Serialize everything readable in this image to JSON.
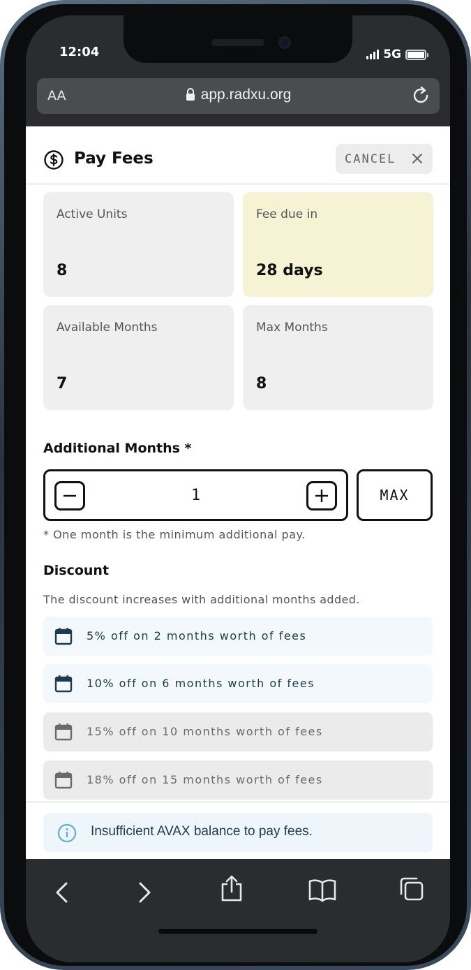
{
  "status_bar": {
    "time": "12:04",
    "network": "5G"
  },
  "browser": {
    "text_size_label": "AA",
    "url": "app.radxu.org"
  },
  "header": {
    "title": "Pay Fees",
    "cancel_label": "CANCEL"
  },
  "stats": [
    {
      "label": "Active Units",
      "value": "8",
      "highlight": false
    },
    {
      "label": "Fee due in",
      "value": "28 days",
      "highlight": true
    },
    {
      "label": "Available Months",
      "value": "7",
      "highlight": false
    },
    {
      "label": "Max Months",
      "value": "8",
      "highlight": false
    }
  ],
  "additional_months": {
    "title": "Additional Months *",
    "value": "1",
    "max_label": "MAX",
    "note": "* One month is the minimum additional pay."
  },
  "discount": {
    "title": "Discount",
    "description": "The discount increases with additional months added.",
    "tiers": [
      {
        "text": "5% off on 2 months worth of fees",
        "state": "active"
      },
      {
        "text": "10% off on 6 months worth of fees",
        "state": "active"
      },
      {
        "text": "15% off on 10 months worth of fees",
        "state": "inactive"
      },
      {
        "text": "18% off on 15 months worth of fees",
        "state": "inactive"
      }
    ]
  },
  "alert": {
    "message": "Insufficient AVAX balance to pay fees.",
    "icon": "info-icon"
  },
  "colors": {
    "highlight_card": "#f6f3d5",
    "active_tier_bg": "#f2f8fb",
    "inactive_tier_bg": "#ebebeb",
    "info_accent": "#5aaed6",
    "text_dark": "#1c3b4d"
  }
}
